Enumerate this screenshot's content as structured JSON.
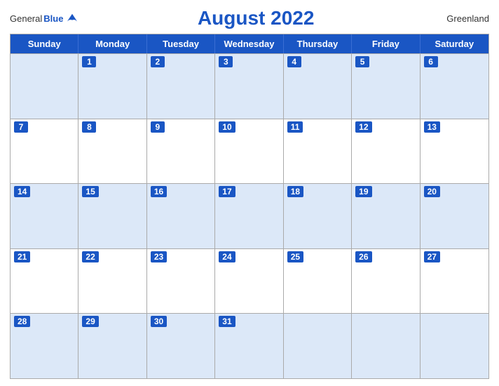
{
  "header": {
    "logo": {
      "general": "General",
      "blue": "Blue",
      "bird_symbol": "▲"
    },
    "title": "August 2022",
    "region": "Greenland"
  },
  "calendar": {
    "days_of_week": [
      "Sunday",
      "Monday",
      "Tuesday",
      "Wednesday",
      "Thursday",
      "Friday",
      "Saturday"
    ],
    "weeks": [
      [
        {
          "day": "",
          "empty": true
        },
        {
          "day": "1"
        },
        {
          "day": "2"
        },
        {
          "day": "3"
        },
        {
          "day": "4"
        },
        {
          "day": "5"
        },
        {
          "day": "6"
        }
      ],
      [
        {
          "day": "7"
        },
        {
          "day": "8"
        },
        {
          "day": "9"
        },
        {
          "day": "10"
        },
        {
          "day": "11"
        },
        {
          "day": "12"
        },
        {
          "day": "13"
        }
      ],
      [
        {
          "day": "14"
        },
        {
          "day": "15"
        },
        {
          "day": "16"
        },
        {
          "day": "17"
        },
        {
          "day": "18"
        },
        {
          "day": "19"
        },
        {
          "day": "20"
        }
      ],
      [
        {
          "day": "21"
        },
        {
          "day": "22"
        },
        {
          "day": "23"
        },
        {
          "day": "24"
        },
        {
          "day": "25"
        },
        {
          "day": "26"
        },
        {
          "day": "27"
        }
      ],
      [
        {
          "day": "28"
        },
        {
          "day": "29"
        },
        {
          "day": "30"
        },
        {
          "day": "31"
        },
        {
          "day": "",
          "empty": true
        },
        {
          "day": "",
          "empty": true
        },
        {
          "day": "",
          "empty": true
        }
      ]
    ]
  }
}
